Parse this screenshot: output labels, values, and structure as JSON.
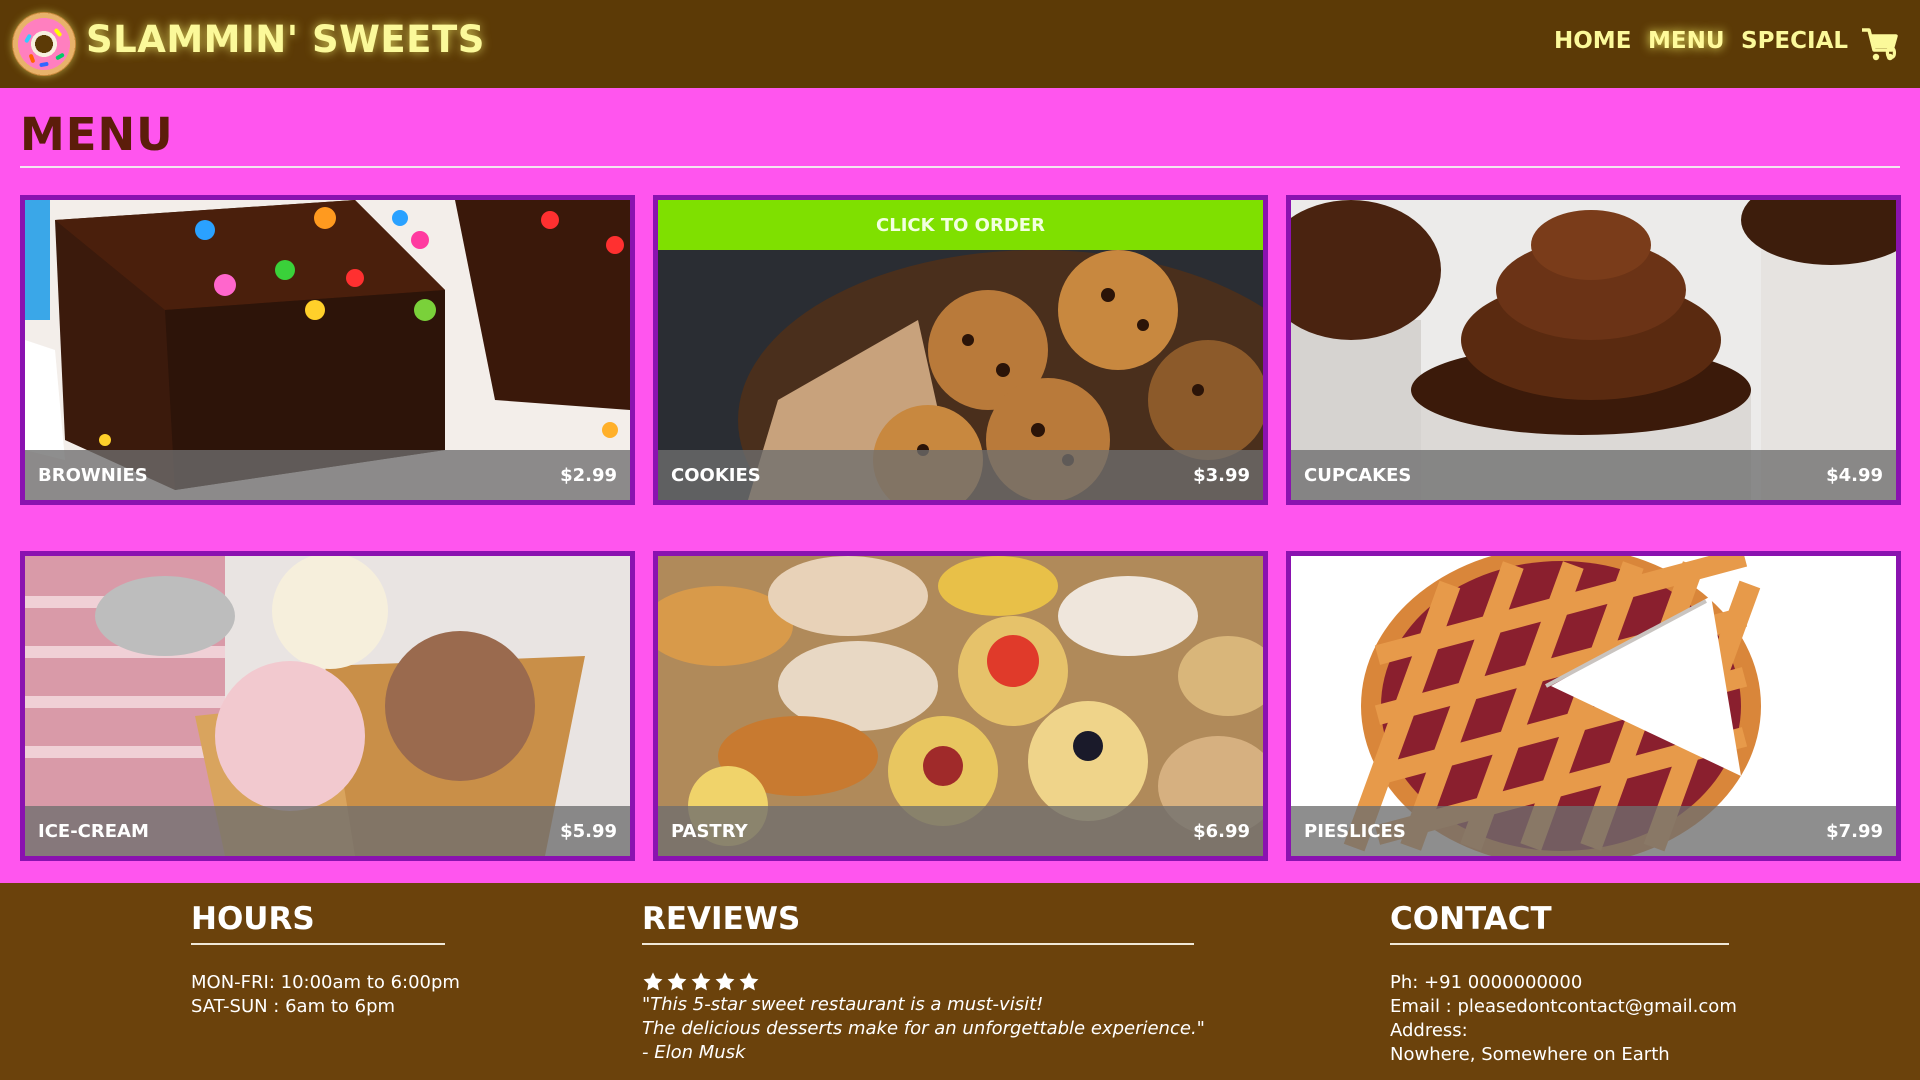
{
  "nav": {
    "brand": "SLAMMIN' SWEETS",
    "links": [
      "HOME",
      "MENU",
      "SPECIAL"
    ],
    "cart_count": "0"
  },
  "menu": {
    "title": "MENU",
    "order_banner": "CLICK TO ORDER",
    "items": [
      {
        "name": "BROWNIES",
        "price": "$2.99"
      },
      {
        "name": "COOKIES",
        "price": "$3.99"
      },
      {
        "name": "CUPCAKES",
        "price": "$4.99"
      },
      {
        "name": "ICE-CREAM",
        "price": "$5.99"
      },
      {
        "name": "PASTRY",
        "price": "$6.99"
      },
      {
        "name": "PIESLICES",
        "price": "$7.99"
      }
    ]
  },
  "footer": {
    "hours": {
      "title": "HOURS",
      "lines": [
        "MON-FRI: 10:00am to 6:00pm",
        "SAT-SUN : 6am to 6pm"
      ]
    },
    "reviews": {
      "title": "REVIEWS",
      "rating": 5,
      "lines": [
        "\"This 5-star sweet restaurant is a must-visit!",
        "The delicious desserts make for an unforgettable experience.\"",
        "- Elon Musk"
      ]
    },
    "contact": {
      "title": "CONTACT",
      "lines": [
        "Ph: +91 0000000000",
        "Email : pleasedontcontact@gmail.com",
        "Address:",
        "Nowhere, Somewhere on Earth"
      ]
    }
  },
  "colors": {
    "nav_bg": "#5c3a06",
    "page_bg": "#ff55ee",
    "card_border": "#8a12b0",
    "order_banner": "#7fe000",
    "footer_bg": "#6b420c",
    "brand_text": "#fbf99a"
  },
  "icons": [
    "donut-logo-icon",
    "shopping-cart-icon",
    "star-icon"
  ]
}
